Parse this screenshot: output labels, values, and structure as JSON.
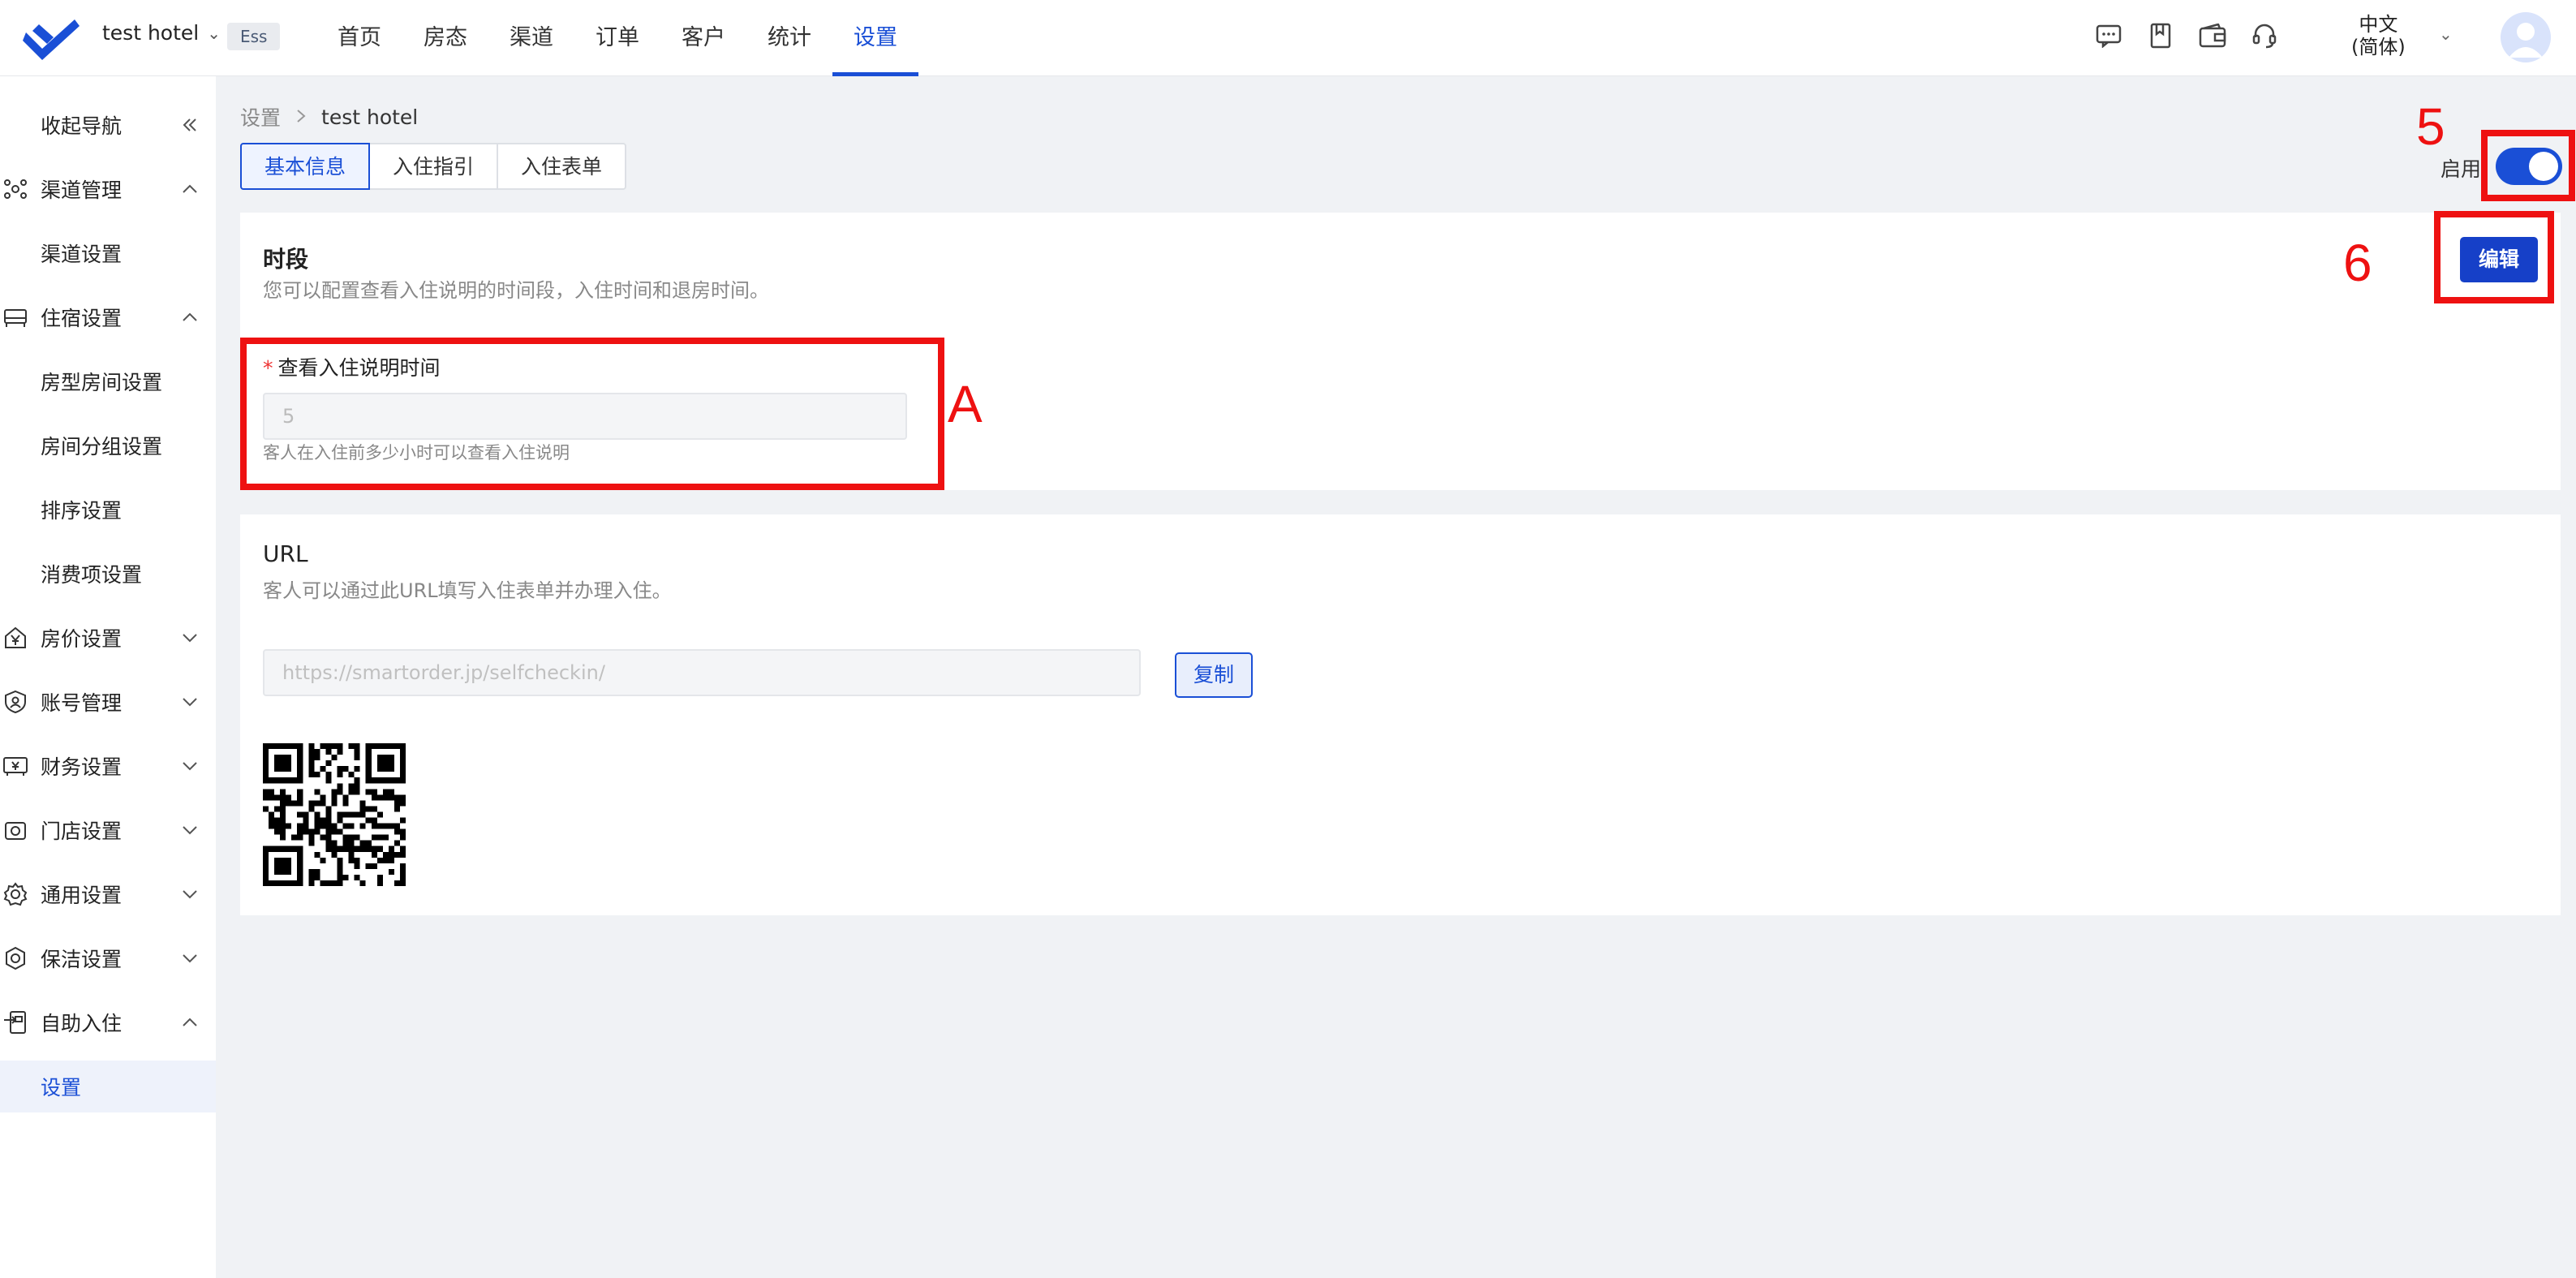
{
  "header": {
    "hotel_name": "test hotel",
    "plan_badge": "Ess",
    "nav": [
      {
        "label": "首页"
      },
      {
        "label": "房态"
      },
      {
        "label": "渠道"
      },
      {
        "label": "订单"
      },
      {
        "label": "客户"
      },
      {
        "label": "统计"
      },
      {
        "label": "设置",
        "active": true
      }
    ],
    "language_line1": "中文",
    "language_line2": "(简体)",
    "icons": [
      "message-icon",
      "bookmark-icon",
      "wallet-icon",
      "headset-icon"
    ]
  },
  "sidebar": {
    "collapse_label": "收起导航",
    "items": [
      {
        "label": "渠道管理",
        "icon": "channel-icon",
        "expanded": true
      },
      {
        "label": "渠道设置",
        "sub": true
      },
      {
        "label": "住宿设置",
        "icon": "bed-icon",
        "expanded": true
      },
      {
        "label": "房型房间设置",
        "sub": true
      },
      {
        "label": "房间分组设置",
        "sub": true
      },
      {
        "label": "排序设置",
        "sub": true
      },
      {
        "label": "消费项设置",
        "sub": true
      },
      {
        "label": "房价设置",
        "icon": "yen-icon",
        "expanded": false
      },
      {
        "label": "账号管理",
        "icon": "shield-user-icon",
        "expanded": false
      },
      {
        "label": "财务设置",
        "icon": "finance-icon",
        "expanded": false
      },
      {
        "label": "门店设置",
        "icon": "store-icon",
        "expanded": false
      },
      {
        "label": "通用设置",
        "icon": "gear-icon",
        "expanded": false
      },
      {
        "label": "保洁设置",
        "icon": "cleaning-icon",
        "expanded": false
      },
      {
        "label": "自助入住",
        "icon": "checkin-icon",
        "expanded": true
      },
      {
        "label": "设置",
        "sub": true,
        "active": true
      }
    ]
  },
  "breadcrumb": {
    "root": "设置",
    "current": "test hotel"
  },
  "tabs": [
    {
      "label": "基本信息",
      "active": true
    },
    {
      "label": "入住指引"
    },
    {
      "label": "入住表单"
    }
  ],
  "enable": {
    "label": "启用",
    "on": true
  },
  "period_card": {
    "title": "时段",
    "description": "您可以配置查看入住说明的时间段，入住时间和退房时间。",
    "edit_label": "编辑",
    "field_label": "查看入住说明时间",
    "field_required_mark": "*",
    "field_value": "5",
    "field_help": "客人在入住前多少小时可以查看入住说明"
  },
  "url_card": {
    "title": "URL",
    "description": "客人可以通过此URL填写入住表单并办理入住。",
    "url_value": "https://smartorder.jp/selfcheckin/",
    "copy_label": "复制"
  },
  "annotations": {
    "toggle_label": "5",
    "edit_label": "6",
    "field_label": "A",
    "color": "#ee1111"
  },
  "colors": {
    "accent": "#1a4fd6",
    "edit_button": "#1640c8",
    "annotation": "#ee1111"
  }
}
